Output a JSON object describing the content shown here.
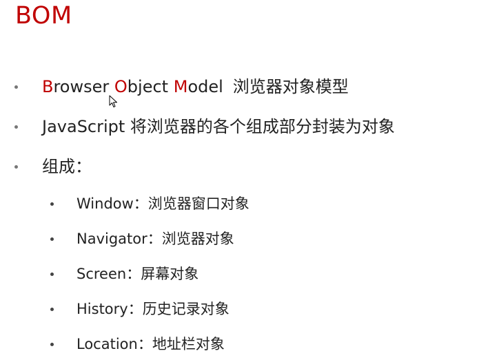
{
  "title": "BOM",
  "bullets": {
    "b1": {
      "w1_initial": "B",
      "w1_rest": "rowser",
      "w2_initial": "O",
      "w2_rest": "bject",
      "w3_initial": "M",
      "w3_rest": "odel",
      "chinese": "浏览器对象模型"
    },
    "b2": "JavaScript 将浏览器的各个组成部分封装为对象",
    "b3": "组成："
  },
  "sub_bullets": [
    "Window：浏览器窗口对象",
    "Navigator：浏览器对象",
    "Screen：屏幕对象",
    "History：历史记录对象",
    "Location：地址栏对象"
  ],
  "colors": {
    "accent": "#c00000",
    "text": "#222222"
  },
  "icons": {
    "pointer": "mouse-pointer-icon"
  }
}
